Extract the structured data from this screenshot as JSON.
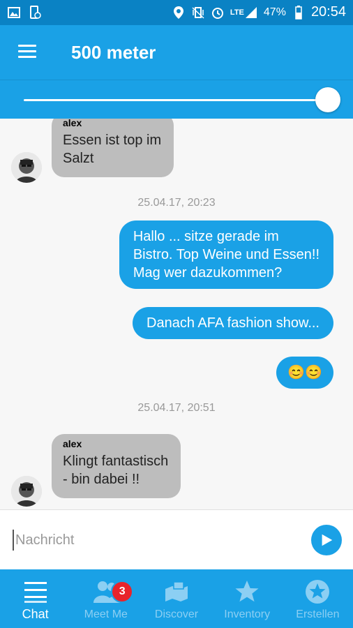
{
  "status_bar": {
    "battery": "47%",
    "time": "20:54",
    "network": "LTE"
  },
  "header": {
    "title": "500 meter"
  },
  "slider": {
    "value_fraction": 1.0
  },
  "messages": [
    {
      "type": "incoming",
      "author": "alex",
      "text_lines": [
        "Essen ist top im",
        "Salzt"
      ]
    },
    {
      "type": "timestamp",
      "text": "25.04.17, 20:23"
    },
    {
      "type": "outgoing",
      "text_lines": [
        "Hallo ... sitze gerade im",
        "Bistro. Top Weine und Essen!!",
        "Mag wer dazukommen?"
      ]
    },
    {
      "type": "outgoing",
      "text_lines": [
        "Danach AFA fashion show..."
      ]
    },
    {
      "type": "outgoing",
      "text_lines": [
        "😊😊"
      ]
    },
    {
      "type": "timestamp",
      "text": "25.04.17, 20:51"
    },
    {
      "type": "incoming",
      "author": "alex",
      "text_lines": [
        "Klingt fantastisch",
        "- bin dabei !!"
      ]
    }
  ],
  "composer": {
    "placeholder": "Nachricht"
  },
  "tabs": [
    {
      "label": "Chat",
      "icon": "chat-list-icon",
      "active": true
    },
    {
      "label": "Meet Me",
      "icon": "people-icon",
      "badge": "3"
    },
    {
      "label": "Discover",
      "icon": "map-icon"
    },
    {
      "label": "Inventory",
      "icon": "star-icon"
    },
    {
      "label": "Erstellen",
      "icon": "star-circle-icon"
    }
  ],
  "colors": {
    "primary": "#1aa1e6",
    "status_bar": "#0a82c4",
    "incoming_bubble": "#bdbdbd",
    "badge": "#e8232b"
  }
}
